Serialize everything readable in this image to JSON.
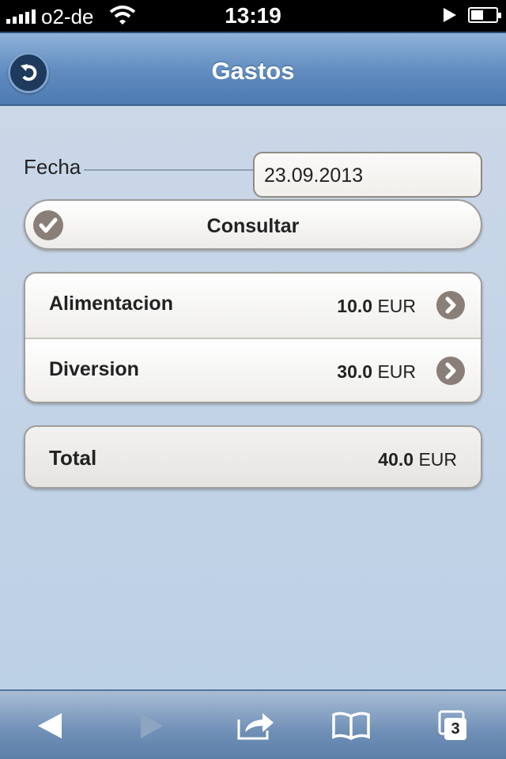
{
  "status_bar": {
    "carrier": "o2-de",
    "time": "13:19",
    "battery_level": 0.5
  },
  "header": {
    "title": "Gastos",
    "back_icon": "back-arrow-icon"
  },
  "form": {
    "date_label": "Fecha",
    "date_value": "23.09.2013",
    "consult_label": "Consultar"
  },
  "expenses": {
    "items": [
      {
        "label": "Alimentacion",
        "amount": "10.0",
        "currency": "EUR"
      },
      {
        "label": "Diversion",
        "amount": "30.0",
        "currency": "EUR"
      }
    ]
  },
  "total": {
    "label": "Total",
    "amount": "40.0",
    "currency": "EUR"
  },
  "toolbar": {
    "tabs_count": "3"
  },
  "colors": {
    "header_blue": "#5f8bbf",
    "background": "#c9d6e6",
    "icon_brown": "#8a7f78"
  }
}
